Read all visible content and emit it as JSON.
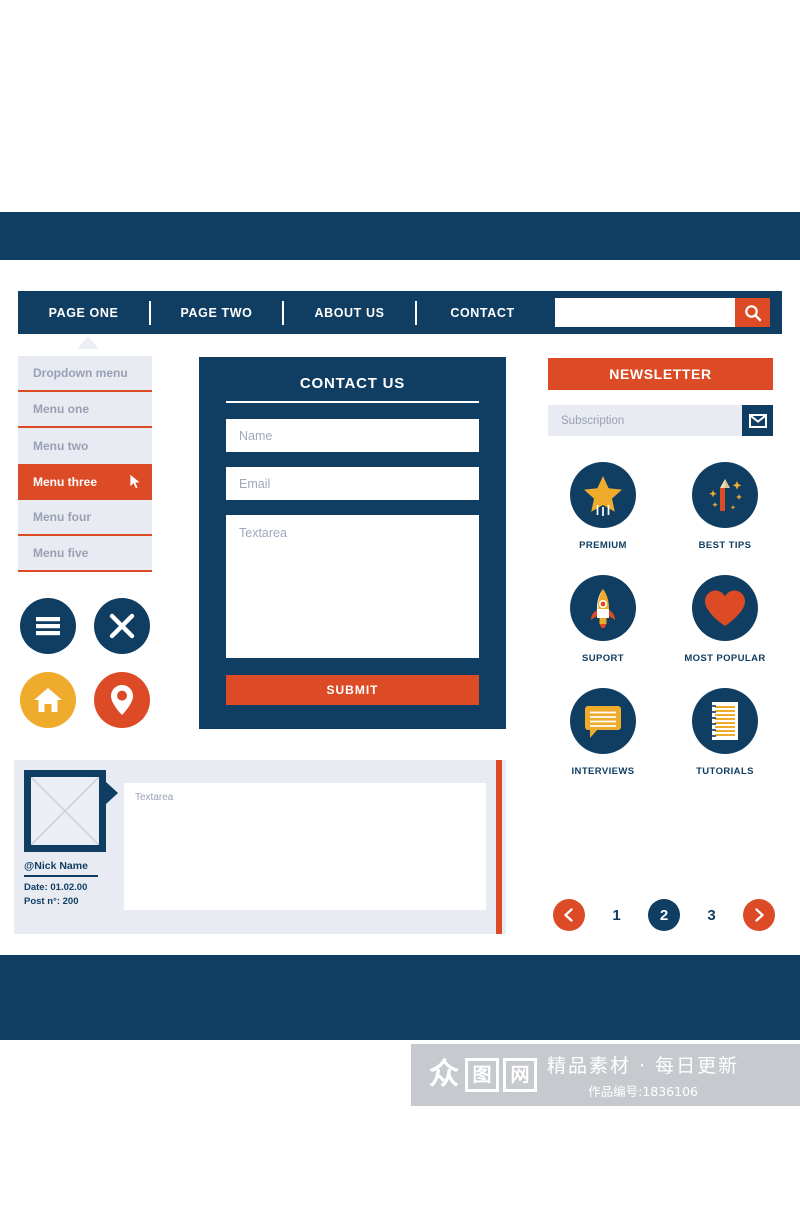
{
  "navbar": {
    "items": [
      {
        "label": "PAGE ONE"
      },
      {
        "label": "PAGE TWO"
      },
      {
        "label": "ABOUT US"
      },
      {
        "label": "CONTACT"
      }
    ],
    "search": {
      "value": "",
      "placeholder": "",
      "icon": "search-icon"
    }
  },
  "dropdown": {
    "items": [
      {
        "label": "Dropdown menu",
        "active": false
      },
      {
        "label": "Menu one",
        "active": false
      },
      {
        "label": "Menu two",
        "active": false
      },
      {
        "label": "Menu three",
        "active": true
      },
      {
        "label": "Menu four",
        "active": false
      },
      {
        "label": "Menu five",
        "active": false
      }
    ]
  },
  "social_icons": [
    {
      "name": "hamburger-icon",
      "color": "#103E62"
    },
    {
      "name": "close-icon",
      "color": "#103E62"
    },
    {
      "name": "home-icon",
      "color": "#EFAB2B"
    },
    {
      "name": "location-pin-icon",
      "color": "#DC4B25"
    }
  ],
  "contact_form": {
    "title": "CONTACT US",
    "name_field": {
      "value": "",
      "placeholder": "Name"
    },
    "email_field": {
      "value": "",
      "placeholder": "Email"
    },
    "textarea": {
      "value": "",
      "placeholder": "Textarea"
    },
    "submit_label": "SUBMIT"
  },
  "post": {
    "avatar_placeholder": "image-placeholder-x",
    "nickname": "@Nick Name",
    "date": "Date: 01.02.00",
    "post_number": "Post n°: 200",
    "textarea": {
      "value": "",
      "placeholder": "Textarea"
    }
  },
  "newsletter": {
    "title": "NEWSLETTER",
    "subscription": {
      "value": "",
      "placeholder": "Subscription"
    },
    "button_icon": "envelope-icon"
  },
  "features": [
    {
      "label": "PREMIUM",
      "icon": "star-icon"
    },
    {
      "label": "BEST TIPS",
      "icon": "pencil-icon"
    },
    {
      "label": "SUPORT",
      "icon": "rocket-icon"
    },
    {
      "label": "MOST POPULAR",
      "icon": "heart-icon"
    },
    {
      "label": "INTERVIEWS",
      "icon": "speech-bubble-icon"
    },
    {
      "label": "TUTORIALS",
      "icon": "notepad-icon"
    }
  ],
  "pagination": {
    "prev_icon": "chevron-left-icon",
    "next_icon": "chevron-right-icon",
    "pages": [
      {
        "label": "1",
        "active": false
      },
      {
        "label": "2",
        "active": true
      },
      {
        "label": "3",
        "active": false
      }
    ]
  },
  "watermark": {
    "logo_chars": [
      "众",
      "图",
      "网"
    ],
    "tagline": "精品素材 · 每日更新",
    "code": "作品编号:1836106"
  },
  "colors": {
    "navy": "#103E62",
    "orange": "#DC4B25",
    "yellow": "#EFAB2B",
    "light_gray": "#e9ebf2"
  }
}
